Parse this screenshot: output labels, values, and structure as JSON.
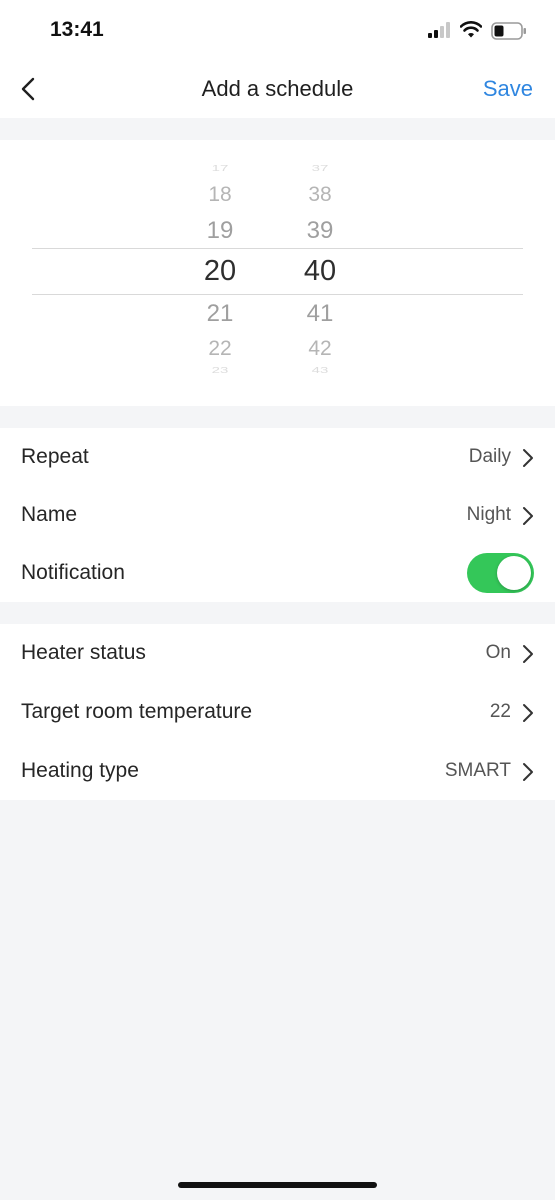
{
  "status_bar": {
    "time": "13:41"
  },
  "nav": {
    "title": "Add a schedule",
    "save_label": "Save"
  },
  "picker": {
    "hours": [
      "17",
      "18",
      "19",
      "20",
      "21",
      "22",
      "23"
    ],
    "minutes": [
      "37",
      "38",
      "39",
      "40",
      "41",
      "42",
      "43"
    ],
    "selected_hour": "20",
    "selected_minute": "40"
  },
  "settings": {
    "repeat": {
      "label": "Repeat",
      "value": "Daily"
    },
    "name": {
      "label": "Name",
      "value": "Night"
    },
    "notification": {
      "label": "Notification",
      "enabled": true
    }
  },
  "heater": {
    "status": {
      "label": "Heater status",
      "value": "On"
    },
    "target_temp": {
      "label": "Target room temperature",
      "value": "22"
    },
    "heating_type": {
      "label": "Heating type",
      "value": "SMART"
    }
  },
  "colors": {
    "accent": "#2f86e0",
    "toggle_on": "#34c759",
    "background": "#f4f5f7"
  }
}
